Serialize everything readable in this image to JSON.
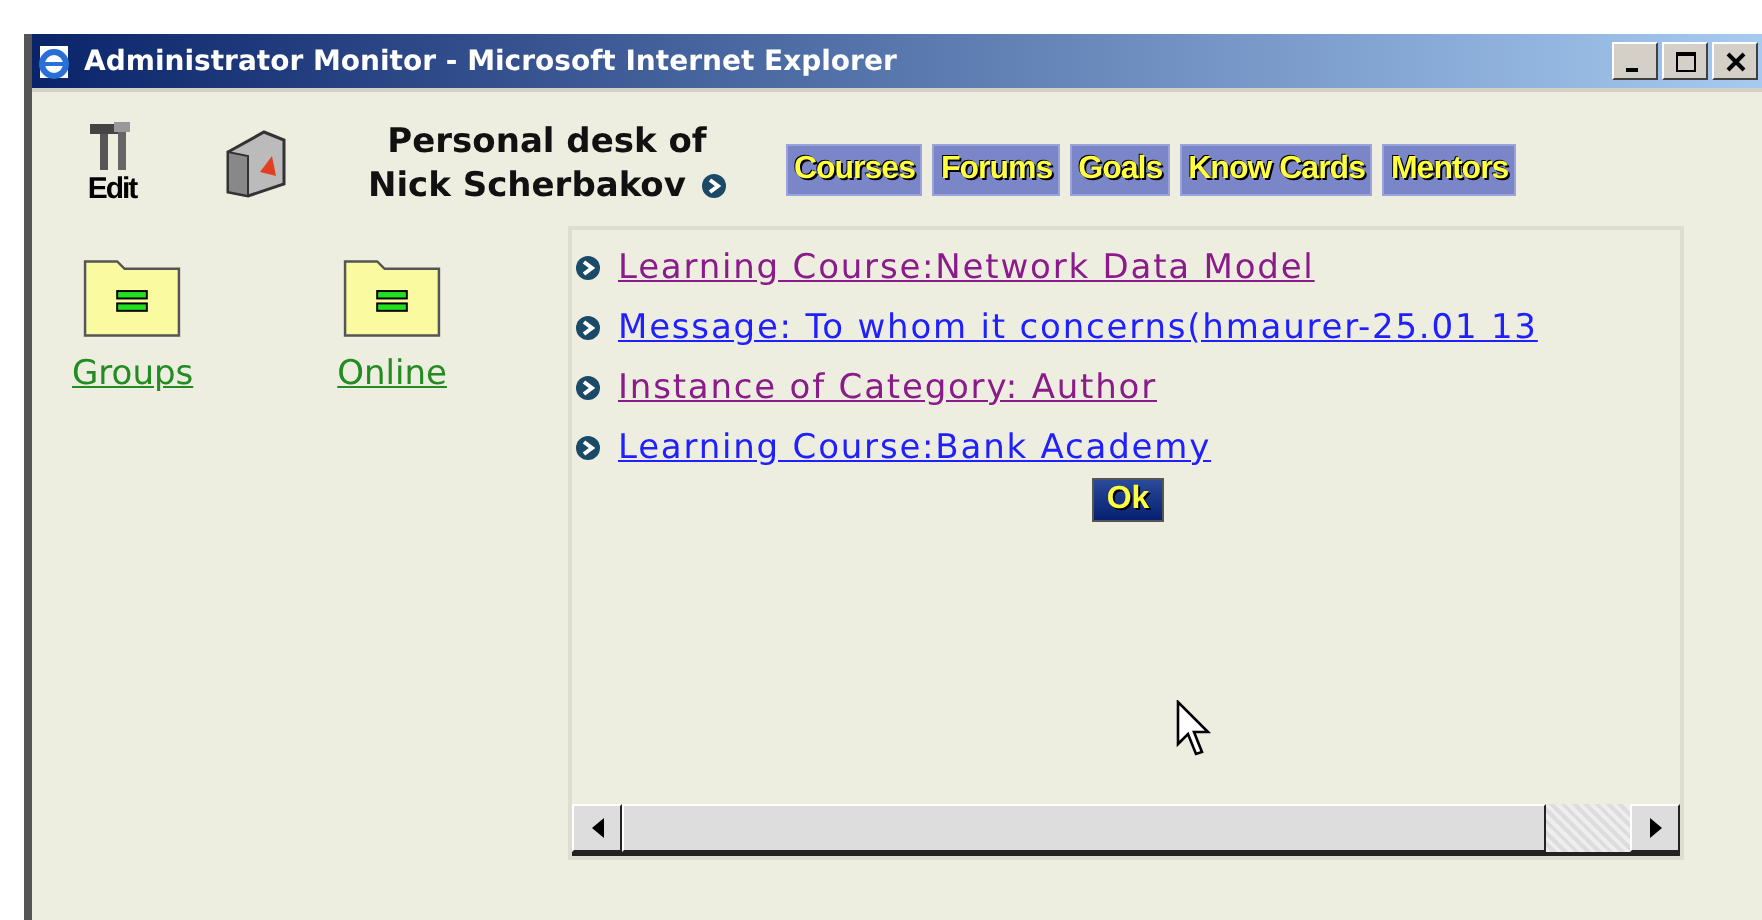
{
  "window": {
    "title": "Administrator Monitor - Microsoft Internet Explorer"
  },
  "toolbar": {
    "edit_label": "Edit",
    "desk_title": [
      "Personal desk of",
      "Nick Scherbakov"
    ]
  },
  "nav_buttons": [
    "Courses",
    "Forums",
    "Goals",
    "Know Cards",
    "Mentors"
  ],
  "folders": [
    {
      "label": "Groups"
    },
    {
      "label": "Online"
    }
  ],
  "links": [
    {
      "text": "Learning Course:Network Data Model",
      "visited": true
    },
    {
      "text": "Message: To whom it concerns(hmaurer-25.01 13",
      "visited": false
    },
    {
      "text": "Instance of Category: Author",
      "visited": true
    },
    {
      "text": "Learning Course:Bank Academy",
      "visited": false
    }
  ],
  "ok_button": "Ok"
}
